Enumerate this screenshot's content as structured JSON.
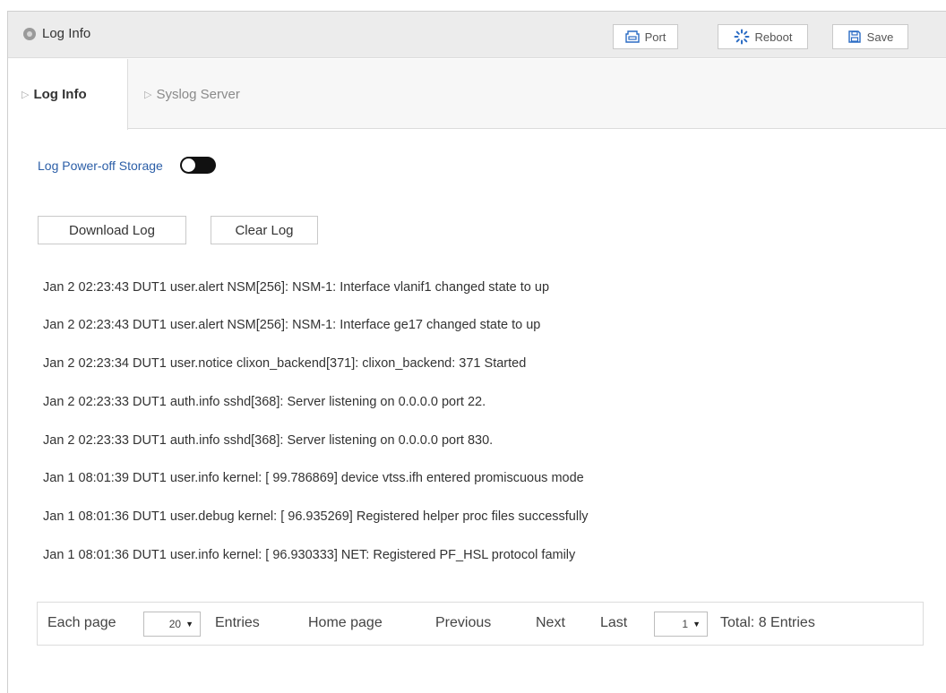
{
  "header": {
    "title": "Log Info",
    "buttons": {
      "port": "Port",
      "reboot": "Reboot",
      "save": "Save"
    }
  },
  "tabs": [
    {
      "label": "Log Info",
      "active": true
    },
    {
      "label": "Syslog Server",
      "active": false
    }
  ],
  "storage": {
    "label": "Log Power-off Storage",
    "enabled": false
  },
  "actions": {
    "download": "Download Log",
    "clear": "Clear Log"
  },
  "logs": [
    "Jan 2 02:23:43 DUT1 user.alert NSM[256]: NSM-1: Interface vlanif1 changed state to up",
    "Jan 2 02:23:43 DUT1 user.alert NSM[256]: NSM-1: Interface ge17 changed state to up",
    "Jan 2 02:23:34 DUT1 user.notice clixon_backend[371]: clixon_backend: 371 Started",
    "Jan 2 02:23:33 DUT1 auth.info sshd[368]: Server listening on 0.0.0.0 port 22.",
    "Jan 2 02:23:33 DUT1 auth.info sshd[368]: Server listening on 0.0.0.0 port 830.",
    "Jan 1 08:01:39 DUT1 user.info kernel: [ 99.786869] device vtss.ifh entered promiscuous mode",
    "Jan 1 08:01:36 DUT1 user.debug kernel: [ 96.935269] Registered helper proc files successfully",
    "Jan 1 08:01:36 DUT1 user.info kernel: [ 96.930333] NET: Registered PF_HSL protocol family"
  ],
  "pagination": {
    "each_page": "Each page",
    "page_size": "20",
    "entries": "Entries",
    "home": "Home page",
    "previous": "Previous",
    "next": "Next",
    "last": "Last",
    "current_page": "1",
    "total": "Total: 8 Entries"
  },
  "colors": {
    "label_blue": "#2b5ea7",
    "header_bg": "#ececec",
    "toggle": "#111111"
  }
}
